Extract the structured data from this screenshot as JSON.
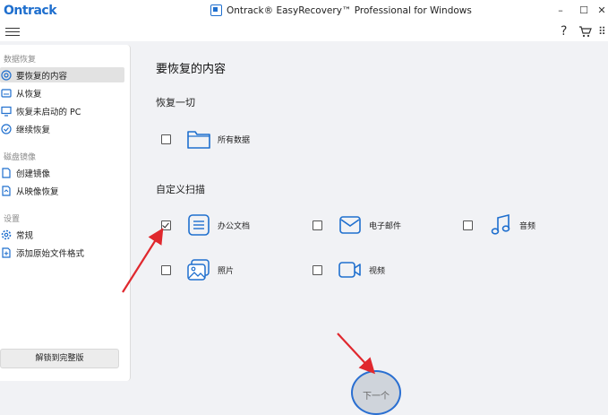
{
  "window": {
    "logo": "Ontrack",
    "title": "Ontrack® EasyRecovery™ Professional for Windows",
    "minimize_glyph": "–",
    "maximize_glyph": "☐",
    "close_glyph": "✕"
  },
  "toolbar": {
    "help_glyph": "?",
    "cart_icon": "cart-icon",
    "apps_glyph": "⠿"
  },
  "sidebar": {
    "sections": [
      {
        "title": "数据恢复",
        "items": [
          {
            "label": "要恢复的内容",
            "icon": "target-icon",
            "active": true
          },
          {
            "label": "从恢复",
            "icon": "drive-icon"
          },
          {
            "label": "恢复未启动的 PC",
            "icon": "pc-icon"
          },
          {
            "label": "继续恢复",
            "icon": "check-circle-icon"
          }
        ]
      },
      {
        "title": "磁盘镜像",
        "items": [
          {
            "label": "创建镜像",
            "icon": "disk-image-icon"
          },
          {
            "label": "从映像恢复",
            "icon": "disk-restore-icon"
          }
        ]
      },
      {
        "title": "设置",
        "items": [
          {
            "label": "常规",
            "icon": "gear-icon"
          },
          {
            "label": "添加原始文件格式",
            "icon": "file-add-icon"
          }
        ]
      }
    ],
    "unlock_label": "解锁到完整版"
  },
  "main": {
    "title": "要恢复的内容",
    "restore_all": {
      "title": "恢复一切",
      "option": {
        "label": "所有数据",
        "icon": "folder-icon",
        "checked": false
      }
    },
    "custom_scan": {
      "title": "自定义扫描",
      "options": [
        {
          "label": "办公文档",
          "icon": "document-icon",
          "checked": true
        },
        {
          "label": "电子邮件",
          "icon": "email-icon",
          "checked": false
        },
        {
          "label": "音频",
          "icon": "music-icon",
          "checked": false
        },
        {
          "label": "照片",
          "icon": "photo-icon",
          "checked": false
        },
        {
          "label": "视频",
          "icon": "video-icon",
          "checked": false
        }
      ]
    },
    "next_label": "下一个"
  },
  "colors": {
    "accent": "#1f6fce",
    "arrow": "#e0282e",
    "background": "#f1f2f5"
  }
}
